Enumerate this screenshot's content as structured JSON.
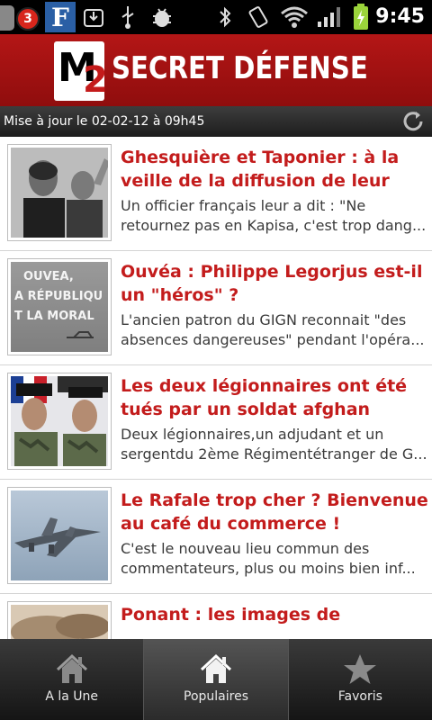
{
  "status_bar": {
    "notification_count": "3",
    "figaro_letter": "F",
    "time": "9:45",
    "icons": [
      "app-icon",
      "figaro-icon",
      "download-icon",
      "usb-icon",
      "android-debug-icon",
      "bluetooth-icon",
      "vibrate-icon",
      "wifi-icon",
      "signal-icon",
      "battery-charging-icon"
    ]
  },
  "header": {
    "logo_m": "M",
    "logo_2": "2",
    "title": "SECRET DÉFENSE"
  },
  "update_bar": {
    "text": "Mise à jour le  02-02-12 à 09h45",
    "refresh_icon": "refresh-icon"
  },
  "articles": [
    {
      "title": "Ghesquière et Taponier : à la veille de la diffusion de leur repo...",
      "summary": "Un officier français leur a dit : \"Ne retournez pas en Kapisa, c'est trop dang..."
    },
    {
      "title": "Ouvéa : Philippe Legorjus est-il un \"héros\" ?",
      "summary": "L'ancien patron du GIGN reconnait \"des absences dangereuses\" pendant l'opéra...",
      "thumb_text": [
        "OUVEA,",
        "A RÉPUBLIQU",
        "T LA MORAL"
      ]
    },
    {
      "title": "Les deux légionnaires ont été tués par un soldat afghan (actua...",
      "summary": "Deux légionnaires,un adjudant et un sergentdu 2ème Régimentétranger de G..."
    },
    {
      "title": "Le Rafale trop cher ? Bienvenue au café du commerce !",
      "summary": "C'est le nouveau lieu commun des commentateurs, plus ou moins bien inf..."
    },
    {
      "title": "Ponant : les images de",
      "summary": ""
    }
  ],
  "bottom_nav": {
    "tabs": [
      {
        "label": "A la Une",
        "icon": "home-icon",
        "active": false
      },
      {
        "label": "Populaires",
        "icon": "home-icon",
        "active": true
      },
      {
        "label": "Favoris",
        "icon": "star-icon",
        "active": false
      }
    ]
  },
  "colors": {
    "header_red": "#b41616",
    "title_red": "#c31c1c",
    "status_black": "#000000"
  }
}
